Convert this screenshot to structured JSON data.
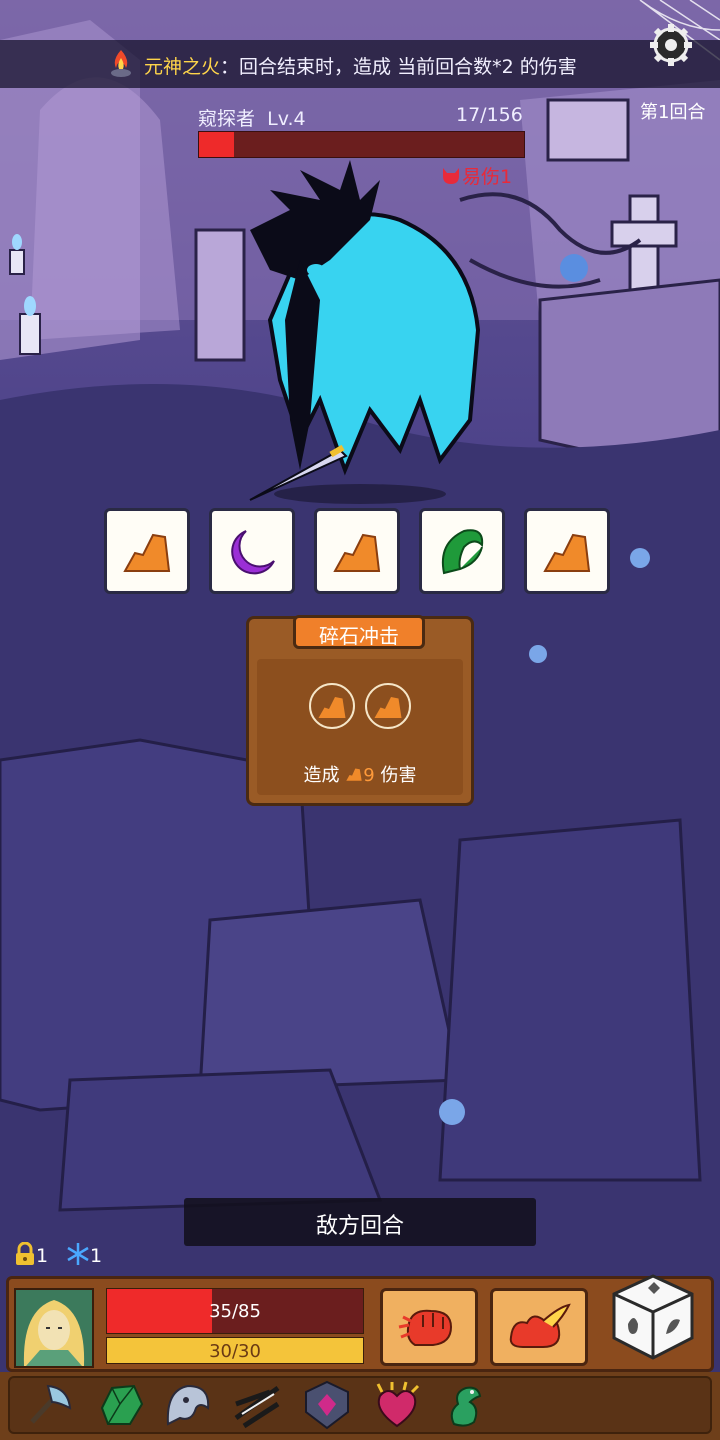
{
  "banner": {
    "relic_name": "元神之火",
    "separator": "：",
    "description": "回合结束时，造成 当前回合数*2 的伤害"
  },
  "settings": {
    "icon": "gear-icon"
  },
  "enemy": {
    "name": "窥探者",
    "level": "Lv.4",
    "hp_text": "17/156",
    "hp_current": 17,
    "hp_max": 156,
    "status_label": "易伤1"
  },
  "round_label": "第1回合",
  "dice": [
    {
      "face": "rock",
      "color": "#f08a2a"
    },
    {
      "face": "moon",
      "color": "#9b2fd6"
    },
    {
      "face": "rock",
      "color": "#f08a2a"
    },
    {
      "face": "leaf",
      "color": "#1f9a3a"
    },
    {
      "face": "rock",
      "color": "#f08a2a"
    }
  ],
  "skill_card": {
    "title": "碎石冲击",
    "slots": [
      "rock",
      "rock"
    ],
    "desc_prefix": "造成",
    "damage_value": "9",
    "desc_suffix": "伤害"
  },
  "turn_label": "敌方回合",
  "counters": {
    "lock_count": "1",
    "freeze_count": "1"
  },
  "player": {
    "hp_text": "35/85",
    "hp_current": 35,
    "hp_max": 85,
    "shield_text": "30/30",
    "shield_current": 30,
    "shield_max": 30
  },
  "skills": [
    {
      "name": "fist-skill"
    },
    {
      "name": "fire-skill"
    }
  ],
  "relics": [
    "axe-icon",
    "gem-icon",
    "ghost-icon",
    "slash-icon",
    "shield-gem-icon",
    "spiked-heart-icon",
    "lizard-icon"
  ],
  "colors": {
    "accent": "#ffd54a",
    "hp": "#ef2a2a",
    "shield": "#f4c43a",
    "card": "#9a5b26",
    "card_head": "#f0802a"
  }
}
